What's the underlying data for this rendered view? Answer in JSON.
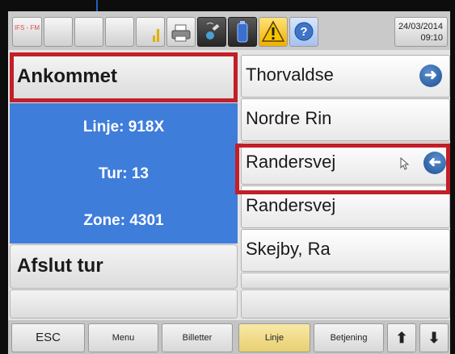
{
  "header": {
    "logo_text": "IFS - FM",
    "date": "24/03/2014",
    "time": "09:10",
    "icons": [
      "ifs-logo-icon",
      "signal-bars-icon",
      "printer-icon",
      "gps-satellite-icon",
      "battery-icon",
      "warning-icon",
      "help-icon"
    ]
  },
  "left_panel": {
    "status_button": "Ankommet",
    "line": "Linje: 918X",
    "trip": "Tur: 13",
    "zone": "Zone: 4301",
    "end_trip_button": "Afslut tur"
  },
  "stops": [
    {
      "name": "Thorvaldse",
      "icon": "arrow-right-circle-icon"
    },
    {
      "name": "Nordre Rin",
      "icon": ""
    },
    {
      "name": "Randersvej",
      "icon": "arrow-left-circle-icon"
    },
    {
      "name": "Randersvej",
      "icon": ""
    },
    {
      "name": "Skejby, Ra",
      "icon": ""
    }
  ],
  "toolbar": {
    "esc": "ESC",
    "menu": "Menu",
    "tickets": "Billetter",
    "line": "Linje",
    "operation": "Betjening",
    "up": "⬆",
    "down": "⬇"
  },
  "colors": {
    "info_panel": "#3f7ddb",
    "highlight": "#c21f28",
    "active_tab": "#f0dc8c",
    "annotation_arrow": "#1f5fbf"
  }
}
